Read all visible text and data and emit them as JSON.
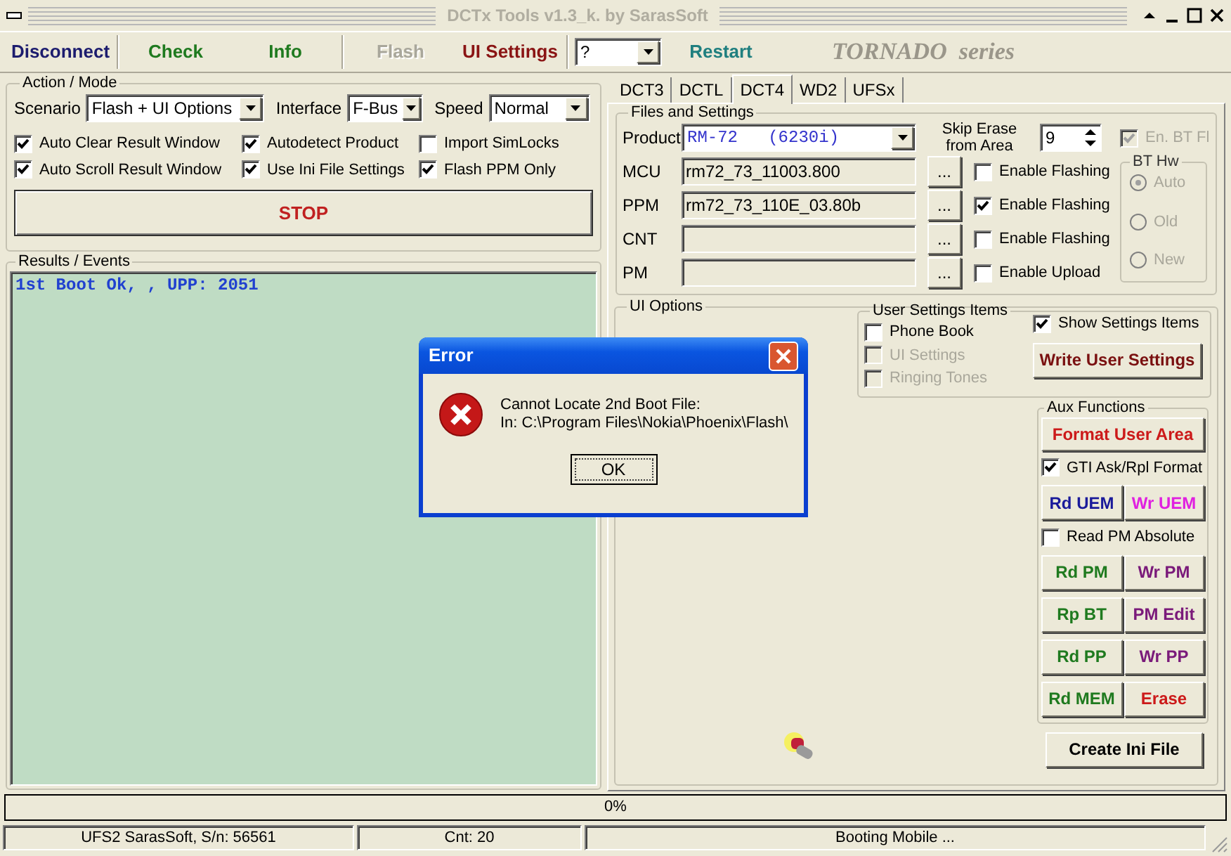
{
  "window": {
    "title": "DCTx Tools v1.3_k. by SarasSoft"
  },
  "toolbar": {
    "groups": [
      [
        {
          "kind": "button",
          "label": "Disconnect",
          "color": "#1c1c6e",
          "disabled": false
        }
      ],
      [
        {
          "kind": "button",
          "label": "Check",
          "color": "#1f7a1f",
          "disabled": false
        },
        {
          "kind": "button",
          "label": "Info",
          "color": "#1f7a1f",
          "disabled": false
        }
      ],
      [
        {
          "kind": "button",
          "label": "Flash",
          "color": "#a9a79b",
          "disabled": true
        },
        {
          "kind": "button",
          "label": "UI Settings",
          "color": "#8a1414",
          "disabled": false
        }
      ],
      [
        {
          "kind": "dropdown",
          "label": "?"
        },
        {
          "kind": "button",
          "label": "Restart",
          "color": "#1f7f7f",
          "disabled": false
        },
        {
          "kind": "logo",
          "label": "TORNADO  series"
        }
      ]
    ]
  },
  "action_mode": {
    "title": "Action / Mode",
    "fields": [
      {
        "label": "Scenario",
        "value": "Flash + UI Options"
      },
      {
        "label": "Interface",
        "value": "F-Bus"
      },
      {
        "label": "Speed",
        "value": "Normal"
      }
    ],
    "checkboxes": [
      {
        "label": "Auto Clear Result Window",
        "checked": true
      },
      {
        "label": "Autodetect Product",
        "checked": true
      },
      {
        "label": "Import SimLocks",
        "checked": false
      },
      {
        "label": "Auto Scroll Result Window",
        "checked": true
      },
      {
        "label": "Use Ini File Settings",
        "checked": true
      },
      {
        "label": "Flash PPM Only",
        "checked": true
      }
    ],
    "stop_button": "STOP"
  },
  "results": {
    "title": "Results / Events",
    "lines": [
      "1st Boot Ok, , UPP: 2051"
    ]
  },
  "tabs": [
    {
      "label": "DCT3",
      "selected": false
    },
    {
      "label": "DCTL",
      "selected": false
    },
    {
      "label": "DCT4",
      "selected": true
    },
    {
      "label": "WD2",
      "selected": false
    },
    {
      "label": "UFSx",
      "selected": false
    }
  ],
  "files_and_settings": {
    "title": "Files and Settings",
    "product": {
      "label": "Product",
      "value": "RM-72   (6230i)"
    },
    "skip_erase": {
      "label": "Skip Erase from Area",
      "value": "9"
    },
    "en_bt_fl": {
      "label": "En. BT Fl",
      "checked": true,
      "disabled": true
    },
    "rows": [
      {
        "label": "MCU",
        "value": "rm72_73_11003.800",
        "browse": "...",
        "option": {
          "label": "Enable Flashing",
          "checked": false
        }
      },
      {
        "label": "PPM",
        "value": "rm72_73_110E_03.80b",
        "browse": "...",
        "option": {
          "label": "Enable Flashing",
          "checked": true
        }
      },
      {
        "label": "CNT",
        "value": "",
        "browse": "...",
        "option": {
          "label": "Enable Flashing",
          "checked": false
        }
      },
      {
        "label": "PM",
        "value": "",
        "browse": "...",
        "option": {
          "label": "Enable Upload",
          "checked": false
        }
      }
    ],
    "bt_hw": {
      "title": "BT Hw",
      "disabled": true,
      "options": [
        {
          "label": "Auto",
          "selected": true
        },
        {
          "label": "Old",
          "selected": false
        },
        {
          "label": "New",
          "selected": false
        }
      ]
    }
  },
  "ui_options": {
    "title": "UI Options",
    "user_settings_items": {
      "title": "User Settings Items",
      "items": [
        {
          "label": "Phone Book",
          "checked": false,
          "disabled": false
        },
        {
          "label": "UI Settings",
          "checked": false,
          "disabled": true
        },
        {
          "label": "Ringing Tones",
          "checked": false,
          "disabled": true
        }
      ]
    },
    "show_settings_items": {
      "label": "Show Settings Items",
      "checked": true
    },
    "write_user_settings": "Write User Settings",
    "aux_functions": {
      "title": "Aux Functions",
      "items": [
        {
          "kind": "button",
          "label": "Format User Area",
          "color": "#cc1a1a"
        },
        {
          "kind": "checkbox",
          "label": "GTI Ask/Rpl Format",
          "checked": true
        },
        {
          "kind": "pair",
          "buttons": [
            {
              "label": "Rd UEM",
              "color": "#1a1a9a"
            },
            {
              "label": "Wr UEM",
              "color": "#e020e0"
            }
          ]
        },
        {
          "kind": "checkbox",
          "label": "Read PM Absolute",
          "checked": false
        },
        {
          "kind": "pair",
          "buttons": [
            {
              "label": "Rd PM",
              "color": "#1f7a1f"
            },
            {
              "label": "Wr PM",
              "color": "#7a1a7a"
            }
          ]
        },
        {
          "kind": "pair",
          "buttons": [
            {
              "label": "Rp BT",
              "color": "#1f7a1f"
            },
            {
              "label": "PM Edit",
              "color": "#7a1a7a"
            }
          ]
        },
        {
          "kind": "pair",
          "buttons": [
            {
              "label": "Rd PP",
              "color": "#1f7a1f"
            },
            {
              "label": "Wr PP",
              "color": "#7a1a7a"
            }
          ]
        },
        {
          "kind": "pair",
          "buttons": [
            {
              "label": "Rd MEM",
              "color": "#1f7a1f"
            },
            {
              "label": "Erase",
              "color": "#cc1a1a"
            }
          ]
        }
      ]
    },
    "create_ini_file": "Create Ini File"
  },
  "progress": {
    "label": "0%",
    "level": 0
  },
  "status_bar": [
    "UFS2 SarasSoft, S/n: 56561",
    "Cnt: 20",
    "Booting Mobile ..."
  ],
  "dialog": {
    "title": "Error",
    "message": [
      "Cannot Locate 2nd Boot File:",
      "In: C:\\Program Files\\Nokia\\Phoenix\\Flash\\"
    ],
    "button": "OK"
  }
}
